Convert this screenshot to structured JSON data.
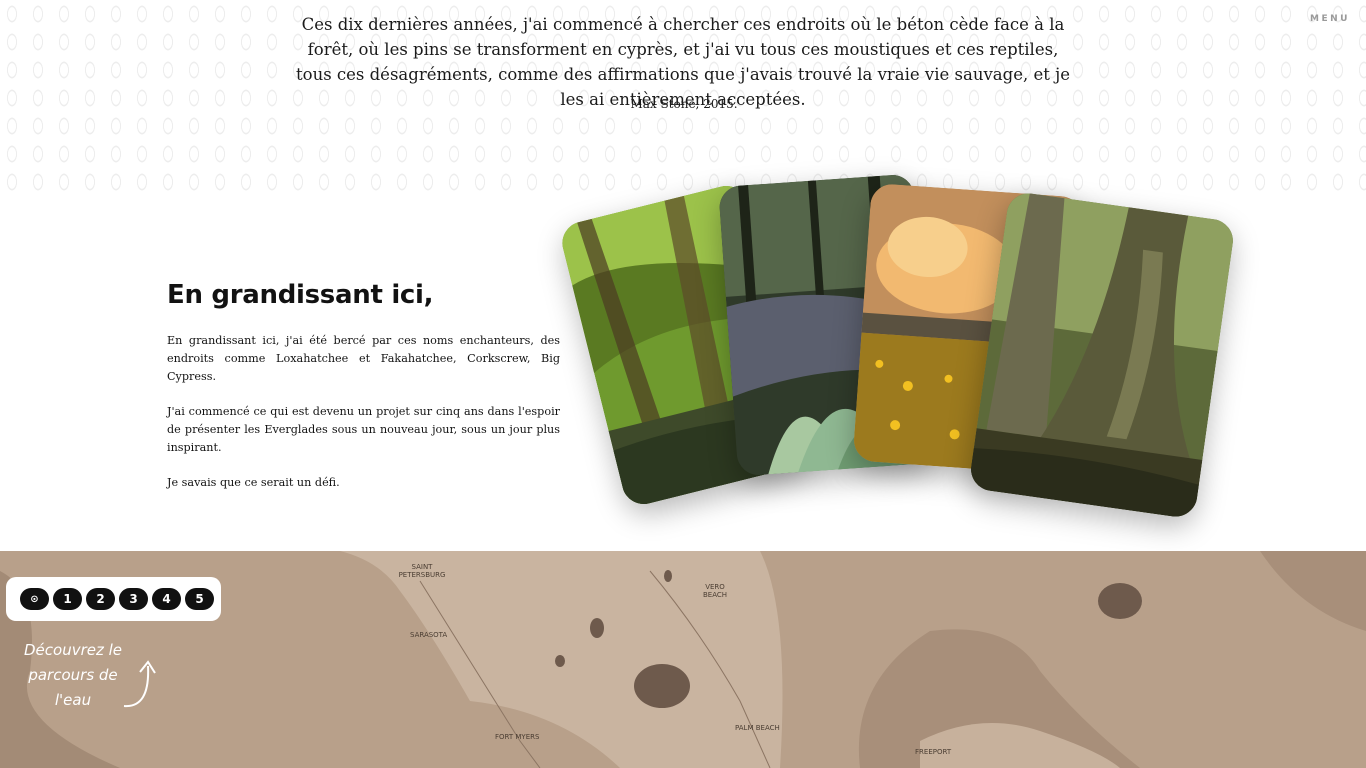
{
  "header": {
    "menu_label": "MENU"
  },
  "quote": {
    "text": "Ces dix dernières années, j'ai commencé à chercher ces endroits où le béton cède face à la forêt, où les pins se transforment en cyprès, et j'ai vu tous ces moustiques et ces reptiles, tous ces désagréments, comme des affirmations que j'avais trouvé la vraie vie sauvage, et je les ai entièrement acceptées.",
    "author": "Max Stone, 2015."
  },
  "section": {
    "title": "En grandissant ici,",
    "paragraphs": [
      "En grandissant ici, j'ai été bercé par ces noms enchanteurs, des endroits comme Loxahatchee et Fakahatchee, Corkscrew, Big Cypress.",
      "J'ai commencé ce qui est devenu un projet sur cinq ans dans l'espoir de présenter les Everglades sous un nouveau jour, sous un jour plus inspirant.",
      "Je savais que ce serait un défi."
    ]
  },
  "gallery": {
    "cards": [
      "mossy-swamp-photo",
      "forest-stream-photo",
      "sunset-flowers-photo",
      "cypress-trunk-photo"
    ]
  },
  "map": {
    "labels": [
      "SAINT PETERSBURG",
      "SARASOTA",
      "FORT MYERS",
      "VERO BEACH",
      "PALM BEACH",
      "FREEPORT"
    ],
    "steps": [
      "⊙",
      "1",
      "2",
      "3",
      "4",
      "5"
    ],
    "cta": "Découvrez le parcours de l'eau",
    "cta_icon": "curved-arrow-icon"
  },
  "colors": {
    "map_bg": "#b8a08a",
    "map_land": "#c9b4a0",
    "map_water": "#6e5a4c"
  }
}
